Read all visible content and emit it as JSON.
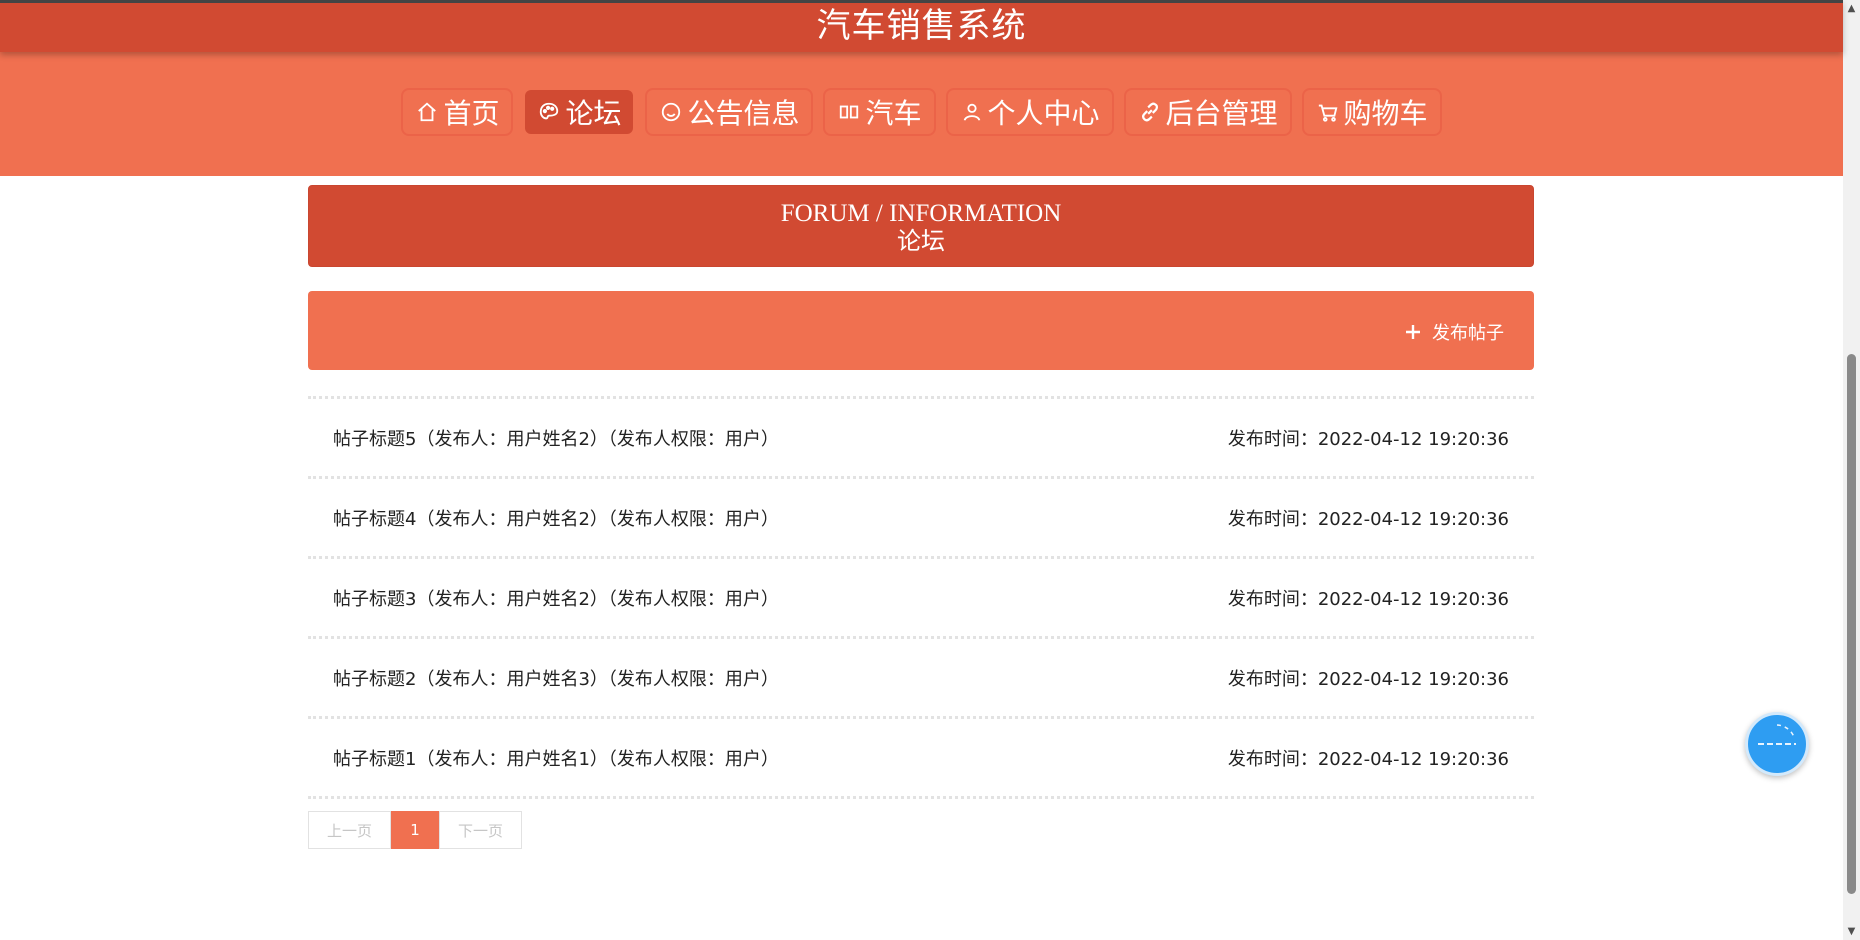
{
  "app": {
    "title": "汽车销售系统"
  },
  "nav": {
    "items": [
      {
        "label": "首页",
        "icon": "home-icon",
        "active": false
      },
      {
        "label": "论坛",
        "icon": "palette-icon",
        "active": true
      },
      {
        "label": "公告信息",
        "icon": "smile-icon",
        "active": false
      },
      {
        "label": "汽车",
        "icon": "columns-icon",
        "active": false
      },
      {
        "label": "个人中心",
        "icon": "user-icon",
        "active": false
      },
      {
        "label": "后台管理",
        "icon": "link-icon",
        "active": false
      },
      {
        "label": "购物车",
        "icon": "cart-icon",
        "active": false
      }
    ]
  },
  "section": {
    "title_en": "FORUM / INFORMATION",
    "title_cn": "论坛"
  },
  "actions": {
    "publish_label": "发布帖子",
    "publish_icon": "plus-icon"
  },
  "posts": [
    {
      "title": "帖子标题5（发布人：用户姓名2）（发布人权限：用户）",
      "time": "发布时间：2022-04-12 19:20:36"
    },
    {
      "title": "帖子标题4（发布人：用户姓名2）（发布人权限：用户）",
      "time": "发布时间：2022-04-12 19:20:36"
    },
    {
      "title": "帖子标题3（发布人：用户姓名2）（发布人权限：用户）",
      "time": "发布时间：2022-04-12 19:20:36"
    },
    {
      "title": "帖子标题2（发布人：用户姓名3）（发布人权限：用户）",
      "time": "发布时间：2022-04-12 19:20:36"
    },
    {
      "title": "帖子标题1（发布人：用户姓名1）（发布人权限：用户）",
      "time": "发布时间：2022-04-12 19:20:36"
    }
  ],
  "pagination": {
    "prev_label": "上一页",
    "current": "1",
    "next_label": "下一页"
  },
  "colors": {
    "primary_dark": "#d14a32",
    "primary": "#f07050",
    "float_button": "#2e9df2"
  }
}
